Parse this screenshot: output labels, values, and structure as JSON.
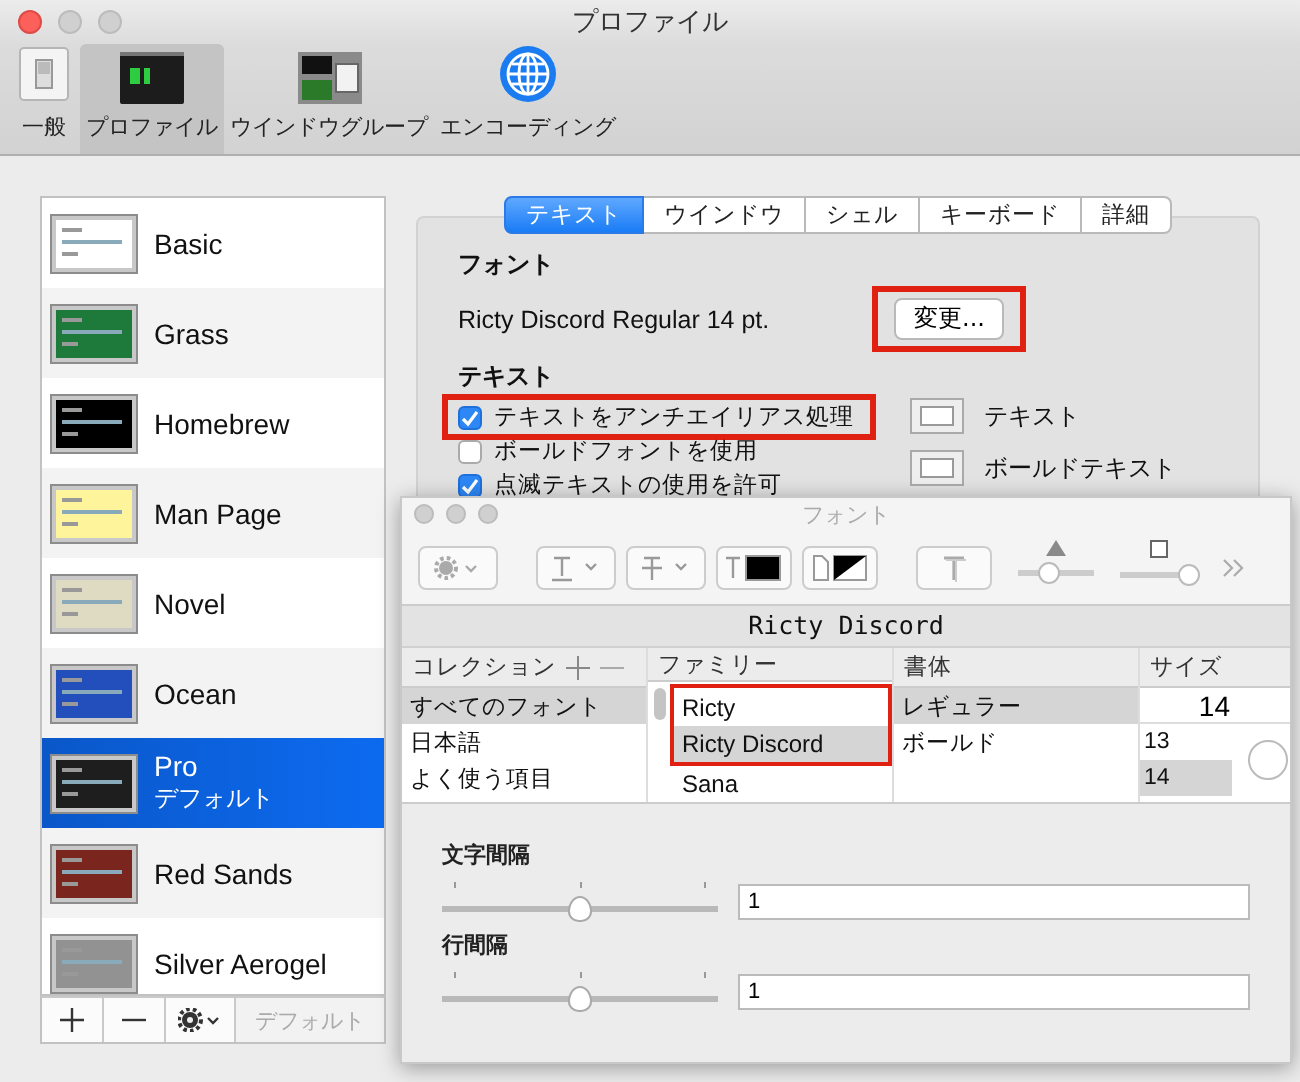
{
  "window": {
    "title": "プロファイル"
  },
  "toolbar": [
    {
      "label": "一般",
      "kind": "switch",
      "selected": false
    },
    {
      "label": "プロファイル",
      "kind": "terminal",
      "selected": true
    },
    {
      "label": "ウインドウグループ",
      "kind": "windows",
      "selected": false
    },
    {
      "label": "エンコーディング",
      "kind": "globe",
      "selected": false
    }
  ],
  "profiles": [
    {
      "name": "Basic",
      "color": "#ffffff",
      "selected": false
    },
    {
      "name": "Grass",
      "color": "#1d7a3a",
      "selected": false
    },
    {
      "name": "Homebrew",
      "color": "#000000",
      "selected": false
    },
    {
      "name": "Man Page",
      "color": "#fef49c",
      "selected": false
    },
    {
      "name": "Novel",
      "color": "#dfdbc3",
      "selected": false
    },
    {
      "name": "Ocean",
      "color": "#224fbc",
      "selected": false
    },
    {
      "name": "Pro",
      "subtitle": "デフォルト",
      "color": "#1e1e1e",
      "selected": true
    },
    {
      "name": "Red Sands",
      "color": "#7a251e",
      "selected": false
    },
    {
      "name": "Silver Aerogel",
      "color": "#929292",
      "selected": false
    }
  ],
  "default_button": {
    "label": "デフォルト",
    "disabled": true
  },
  "tabs": [
    {
      "label": "テキスト",
      "selected": true
    },
    {
      "label": "ウインドウ",
      "selected": false
    },
    {
      "label": "シェル",
      "selected": false
    },
    {
      "label": "キーボード",
      "selected": false
    },
    {
      "label": "詳細",
      "selected": false
    }
  ],
  "font": {
    "heading": "フォント",
    "value": "Ricty Discord Regular 14 pt.",
    "change_button": {
      "label": "変更...",
      "highlighted": true
    }
  },
  "text": {
    "heading": "テキスト",
    "options": [
      {
        "label": "テキストをアンチエイリアス処理",
        "checked": true,
        "highlighted": true
      },
      {
        "label": "ボールドフォントを使用",
        "checked": false,
        "highlighted": false
      },
      {
        "label": "点滅テキストの使用を許可",
        "checked": true,
        "highlighted": false
      }
    ],
    "color_wells": [
      {
        "label": "テキスト"
      },
      {
        "label": "ボールドテキスト"
      }
    ]
  },
  "font_panel": {
    "title": "フォント",
    "toolbar_sliders": [
      {
        "kind": "shadow-opacity",
        "level": 0.4
      },
      {
        "kind": "shadow-blur",
        "level": 0.9
      }
    ],
    "preview": "Ricty Discord",
    "columns": [
      "コレクション",
      "ファミリー",
      "書体",
      "サイズ"
    ],
    "collections": [
      {
        "label": "すべてのフォント",
        "selected": true
      },
      {
        "label": "日本語",
        "selected": false
      },
      {
        "label": "よく使う項目",
        "selected": false
      }
    ],
    "families": [
      {
        "label": "Ricty",
        "selected": false,
        "highlighted": true
      },
      {
        "label": "Ricty Discord",
        "selected": true,
        "highlighted": true
      },
      {
        "label": "Sana",
        "selected": false,
        "highlighted": false
      }
    ],
    "typefaces": [
      {
        "label": "レギュラー",
        "selected": true
      },
      {
        "label": "ボールド",
        "selected": false
      }
    ],
    "size_value": "14",
    "sizes": [
      {
        "label": "13",
        "selected": false
      },
      {
        "label": "14",
        "selected": true
      }
    ],
    "spacing": [
      {
        "label": "文字間隔",
        "level": 0.5,
        "value": "1"
      },
      {
        "label": "行間隔",
        "level": 0.5,
        "value": "1"
      }
    ]
  }
}
